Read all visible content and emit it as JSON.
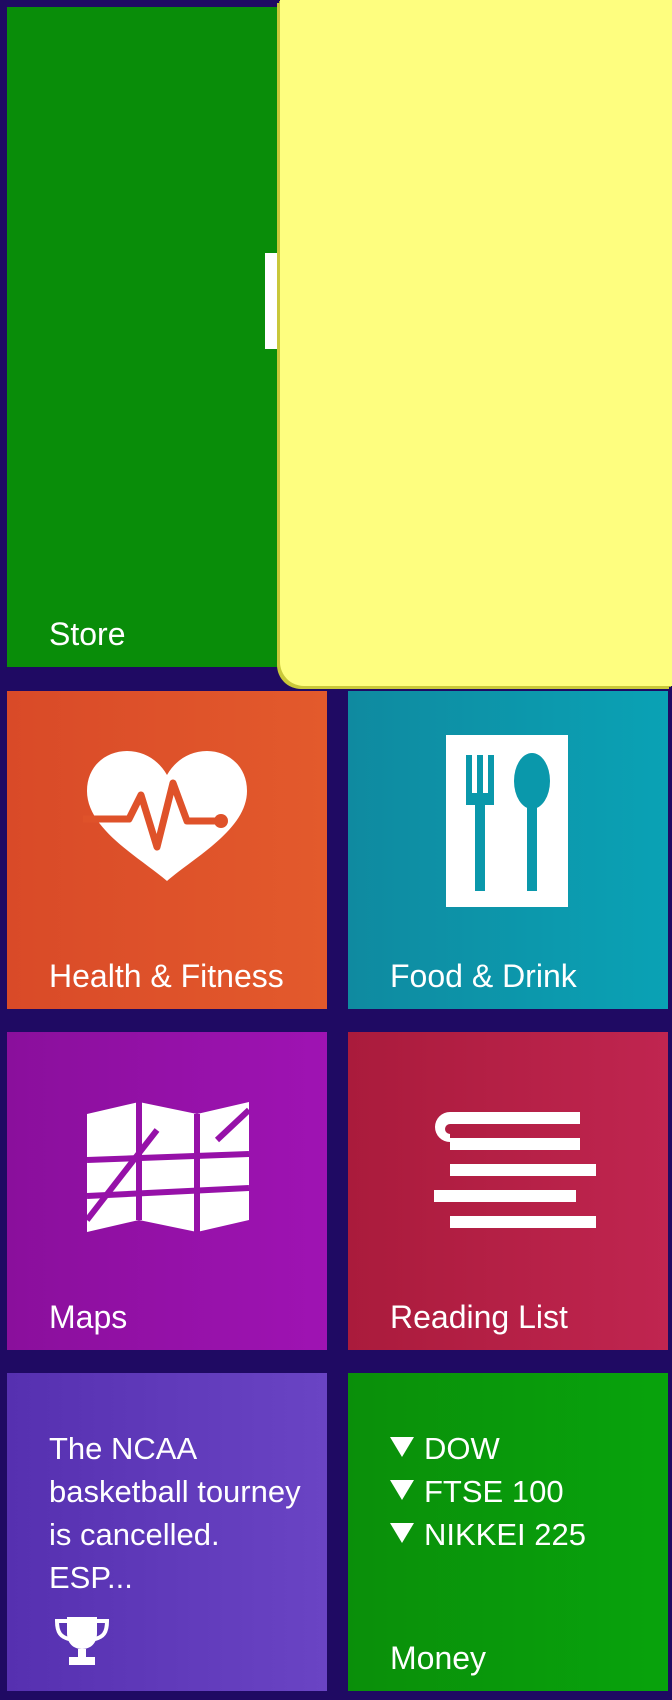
{
  "tiles": {
    "store": {
      "label": "Store",
      "icon": "store-icon",
      "color": "#098d09"
    },
    "health": {
      "label": "Health & Fitness",
      "icon": "heart-pulse-icon",
      "color": "#df522a"
    },
    "food": {
      "label": "Food & Drink",
      "icon": "fork-spoon-icon",
      "color": "#0a98ab"
    },
    "maps": {
      "label": "Maps",
      "icon": "map-icon",
      "color": "#9611a8"
    },
    "reading": {
      "label": "Reading List",
      "icon": "reading-list-icon",
      "color": "#b62047"
    },
    "news": {
      "headline": "The NCAA basketball tourney is cancelled. ESP...",
      "icon": "trophy-icon",
      "color": "#6038bc"
    },
    "money": {
      "label": "Money",
      "color": "#0a990a",
      "indices": [
        {
          "direction": "down",
          "name": "DOW"
        },
        {
          "direction": "down",
          "name": "FTSE 100"
        },
        {
          "direction": "down",
          "name": "NIKKEI 225"
        }
      ]
    }
  },
  "sticky_note": {
    "color": "#fefe7f"
  },
  "background": "#1f0a63"
}
